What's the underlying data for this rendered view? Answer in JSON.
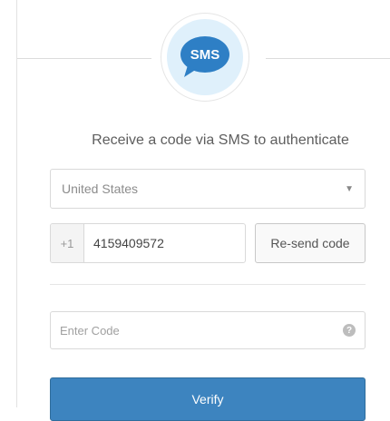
{
  "header": {
    "badge_text": "SMS",
    "badge_color": "#2e7fc5",
    "badge_bg": "#dff0fb"
  },
  "title": "Receive a code via SMS to authenticate",
  "country_select": {
    "value": "United States"
  },
  "phone": {
    "country_code": "+1",
    "number": "4159409572",
    "resend_label": "Re-send code"
  },
  "code": {
    "placeholder": "Enter Code",
    "help_symbol": "?"
  },
  "verify": {
    "label": "Verify",
    "color": "#3d84bf"
  }
}
